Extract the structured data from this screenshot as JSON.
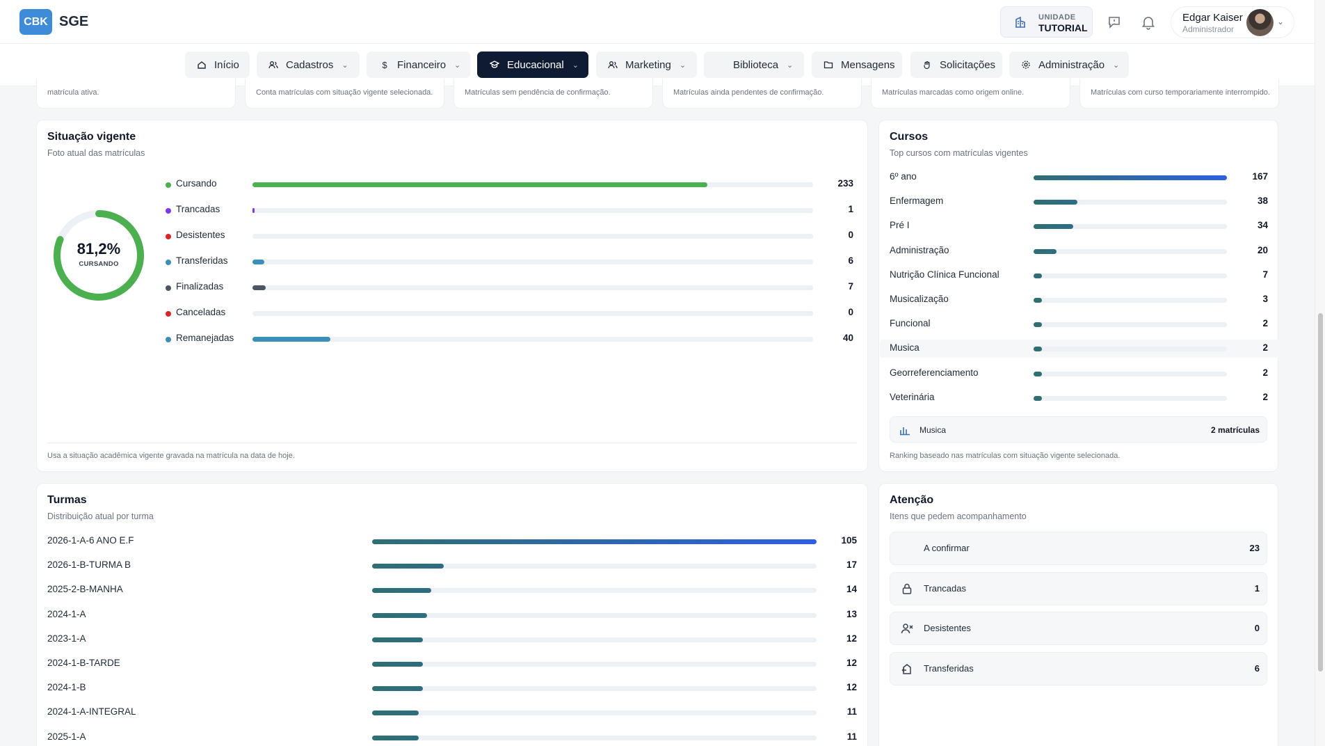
{
  "header": {
    "logo": "CBK",
    "app_name": "SGE",
    "unit_label": "UNIDADE",
    "unit_name": "TUTORIAL",
    "user_name": "Edgar Kaiser",
    "user_role": "Administrador"
  },
  "nav": {
    "items": [
      {
        "label": "Início",
        "icon": "home-icon"
      },
      {
        "label": "Cadastros",
        "icon": "users-icon"
      },
      {
        "label": "Financeiro",
        "icon": "dollar-icon"
      },
      {
        "label": "Educacional",
        "icon": "graduation-cap-icon"
      },
      {
        "label": "Marketing",
        "icon": "users-icon"
      },
      {
        "label": "Biblioteca",
        "icon": "book-icon"
      },
      {
        "label": "Mensagens",
        "icon": "folder-icon"
      },
      {
        "label": "Solicitações",
        "icon": "hand-icon"
      },
      {
        "label": "Administração",
        "icon": "settings-icon"
      }
    ],
    "active": "Educacional"
  },
  "top_cards": [
    "matrícula ativa.",
    "Conta matrículas com situação vigente selecionada.",
    "Matrículas sem pendência de confirmação.",
    "Matrículas ainda pendentes de confirmação.",
    "Matrículas marcadas como origem online.",
    "Matrículas com curso temporariamente interrompido."
  ],
  "situacao": {
    "title": "Situação vigente",
    "subtitle": "Foto atual das matrículas",
    "donut_pct": "81,2%",
    "donut_caption": "CURSANDO",
    "donut_fraction": 0.812,
    "footnote": "Usa a situação acadêmica vigente gravada na matrícula na data de hoje.",
    "items": [
      {
        "label": "Cursando",
        "value": "233",
        "fraction": 0.812,
        "color": "#4caf50"
      },
      {
        "label": "Trancadas",
        "value": "1",
        "fraction": 0.004,
        "color": "#7c3aed"
      },
      {
        "label": "Desistentes",
        "value": "0",
        "fraction": 0,
        "color": "#dc2626"
      },
      {
        "label": "Transferidas",
        "value": "6",
        "fraction": 0.021,
        "color": "#3a8fb7"
      },
      {
        "label": "Finalizadas",
        "value": "7",
        "fraction": 0.024,
        "color": "#4b5563"
      },
      {
        "label": "Canceladas",
        "value": "0",
        "fraction": 0,
        "color": "#dc2626"
      },
      {
        "label": "Remanejadas",
        "value": "40",
        "fraction": 0.139,
        "color": "#3a8fb7"
      }
    ]
  },
  "cursos": {
    "title": "Cursos",
    "subtitle": "Top cursos com matrículas vigentes",
    "items": [
      {
        "label": "6º ano",
        "value": "167"
      },
      {
        "label": "Enfermagem",
        "value": "38"
      },
      {
        "label": "Pré I",
        "value": "34"
      },
      {
        "label": "Administração",
        "value": "20"
      },
      {
        "label": "Nutrição Clínica Funcional",
        "value": "7"
      },
      {
        "label": "Musicalização",
        "value": "3"
      },
      {
        "label": "Funcional",
        "value": "2"
      },
      {
        "label": "Musica",
        "value": "2"
      },
      {
        "label": "Georreferenciamento",
        "value": "2"
      },
      {
        "label": "Veterinária",
        "value": "2"
      }
    ],
    "summary_label": "Musica",
    "summary_value": "2 matrículas",
    "footnote": "Ranking baseado nas matrículas com situação vigente selecionada."
  },
  "turmas": {
    "title": "Turmas",
    "subtitle": "Distribuição atual por turma",
    "items": [
      {
        "label": "2026-1-A-6 ANO E.F",
        "value": "105"
      },
      {
        "label": "2026-1-B-TURMA B",
        "value": "17"
      },
      {
        "label": "2025-2-B-MANHA",
        "value": "14"
      },
      {
        "label": "2024-1-A",
        "value": "13"
      },
      {
        "label": "2023-1-A",
        "value": "12"
      },
      {
        "label": "2024-1-B-TARDE",
        "value": "12"
      },
      {
        "label": "2024-1-B",
        "value": "12"
      },
      {
        "label": "2024-1-A-INTEGRAL",
        "value": "11"
      },
      {
        "label": "2025-1-A",
        "value": "11"
      }
    ]
  },
  "atencao": {
    "title": "Atenção",
    "subtitle": "Itens que pedem acompanhamento",
    "items": [
      {
        "label": "A confirmar",
        "value": "23",
        "icon": "clock-icon"
      },
      {
        "label": "Trancadas",
        "value": "1",
        "icon": "lock-icon"
      },
      {
        "label": "Desistentes",
        "value": "0",
        "icon": "user-x-icon"
      },
      {
        "label": "Transferidas",
        "value": "6",
        "icon": "transfer-icon"
      }
    ]
  },
  "colors": {
    "accent_dark": "#0f1b33",
    "logo_blue": "#3d8bd9",
    "bar_gradient_start": "#2f6f73",
    "bar_gradient_end": "#2f5fe0"
  }
}
